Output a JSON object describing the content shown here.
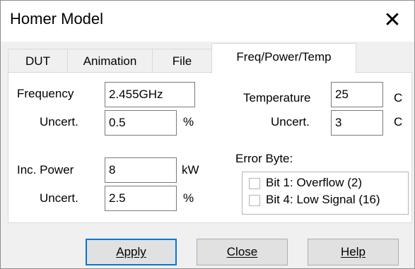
{
  "window": {
    "title": "Homer Model",
    "close_glyph": "✕"
  },
  "tabs": [
    {
      "label": "DUT",
      "active": false
    },
    {
      "label": "Animation",
      "active": false
    },
    {
      "label": "File",
      "active": false
    },
    {
      "label": "Freq/Power/Temp",
      "active": true
    }
  ],
  "freq": {
    "frequency_label": "Frequency",
    "frequency_value": "2.455GHz",
    "freq_uncert_label": "Uncert.",
    "freq_uncert_value": "0.5",
    "freq_uncert_unit": "%"
  },
  "power": {
    "inc_power_label": "Inc. Power",
    "inc_power_value": "8",
    "inc_power_unit": "kW",
    "power_uncert_label": "Uncert.",
    "power_uncert_value": "2.5",
    "power_uncert_unit": "%"
  },
  "temp": {
    "temperature_label": "Temperature",
    "temperature_value": "25",
    "temperature_unit": "C",
    "temp_uncert_label": "Uncert.",
    "temp_uncert_value": "3",
    "temp_uncert_unit": "C"
  },
  "error_byte": {
    "label": "Error Byte:",
    "options": [
      {
        "label": "Bit 1: Overflow (2)",
        "checked": false
      },
      {
        "label": "Bit 4: Low Signal (16)",
        "checked": false
      }
    ]
  },
  "buttons": {
    "apply": "Apply",
    "close": "Close",
    "help": "Help"
  },
  "colors": {
    "focus_border": "#0078d7",
    "button_face": "#e1e1e1",
    "dialog_bg": "#f0f0f0"
  }
}
